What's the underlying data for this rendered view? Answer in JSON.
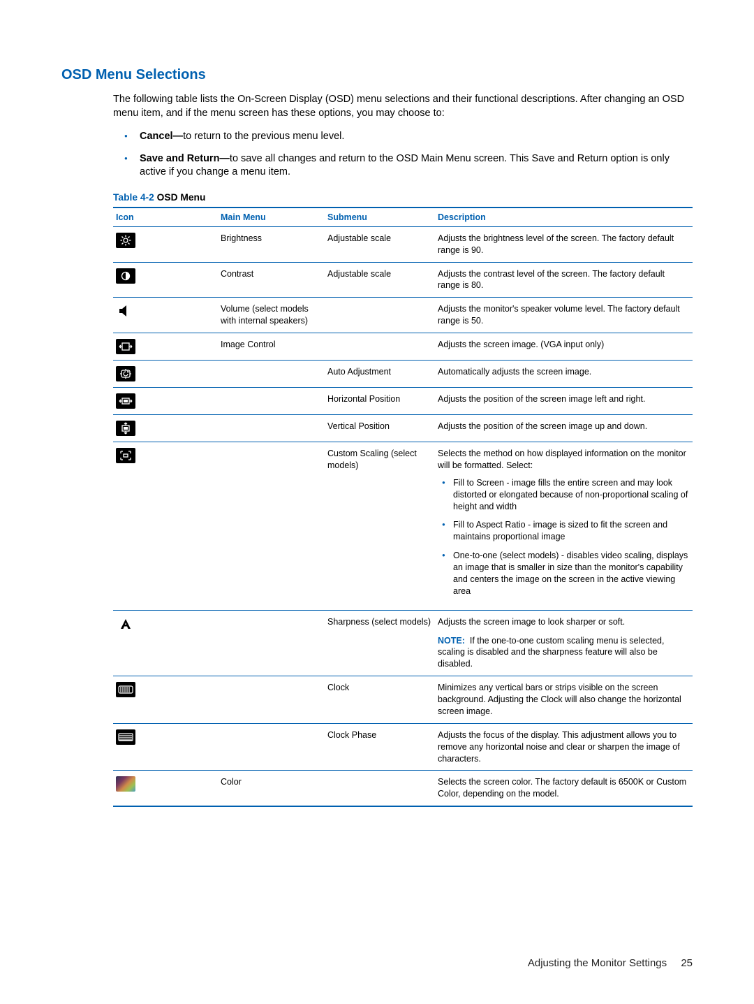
{
  "heading": "OSD Menu Selections",
  "intro": "The following table lists the On-Screen Display (OSD) menu selections and their functional descriptions. After changing an OSD menu item, and if the menu screen has these options, you may choose to:",
  "bullets": [
    {
      "b": "Cancel—",
      "t": "to return to the previous menu level."
    },
    {
      "b": "Save and Return—",
      "t": "to save all changes and return to the OSD Main Menu screen. This Save and Return option is only active if you change a menu item."
    }
  ],
  "table": {
    "caption_num": "Table 4-2",
    "caption_title": "  OSD Menu",
    "headers": {
      "icon": "Icon",
      "main": "Main Menu",
      "sub": "Submenu",
      "desc": "Description"
    },
    "rows": [
      {
        "icon": "brightness",
        "main": "Brightness",
        "sub": "Adjustable scale",
        "desc": "Adjusts the brightness level of the screen. The factory default range is 90."
      },
      {
        "icon": "contrast",
        "main": "Contrast",
        "sub": "Adjustable scale",
        "desc": "Adjusts the contrast level of the screen. The factory default range is 80."
      },
      {
        "icon": "volume",
        "main": "Volume (select models with internal speakers)",
        "sub": "",
        "desc": "Adjusts the monitor's speaker volume level. The factory default range is 50."
      },
      {
        "icon": "image-control",
        "main": "Image Control",
        "sub": "",
        "desc": "Adjusts the screen image. (VGA input only)"
      },
      {
        "icon": "auto-adjust",
        "main": "",
        "sub": "Auto Adjustment",
        "desc": "Automatically adjusts the screen image."
      },
      {
        "icon": "h-position",
        "main": "",
        "sub": "Horizontal Position",
        "desc": "Adjusts the position of the screen image left and right."
      },
      {
        "icon": "v-position",
        "main": "",
        "sub": "Vertical Position",
        "desc": "Adjusts the position of the screen image up and down."
      },
      {
        "icon": "custom-scaling",
        "main": "",
        "sub": "Custom Scaling (select models)",
        "desc": "Selects the method on how displayed information on the monitor will be formatted. Select:",
        "subitems": [
          "Fill to Screen - image fills the entire screen and may look distorted or elongated because of non-proportional scaling of height and width",
          "Fill to Aspect Ratio - image is sized to fit the screen and maintains proportional image",
          "One-to-one (select models) - disables video scaling, displays an image that is smaller in size than the monitor's capability and centers the image on the screen in the active viewing area"
        ]
      },
      {
        "icon": "sharpness",
        "main": "",
        "sub": "Sharpness (select models)",
        "desc": "Adjusts the screen image to look sharper or soft.",
        "note": "If the one-to-one custom scaling menu is selected, scaling is disabled and the sharpness feature will also be disabled."
      },
      {
        "icon": "clock",
        "main": "",
        "sub": "Clock",
        "desc": "Minimizes any vertical bars or strips visible on the screen background. Adjusting the Clock will also change the horizontal screen image."
      },
      {
        "icon": "clock-phase",
        "main": "",
        "sub": "Clock Phase",
        "desc": "Adjusts the focus of the display. This adjustment allows you to remove any horizontal noise and clear or sharpen the image of characters."
      },
      {
        "icon": "color",
        "main": "Color",
        "sub": "",
        "desc": "Selects the screen color. The factory default is 6500K or Custom Color, depending on the model."
      }
    ]
  },
  "footer": {
    "section": "Adjusting the Monitor Settings",
    "page": "25"
  }
}
